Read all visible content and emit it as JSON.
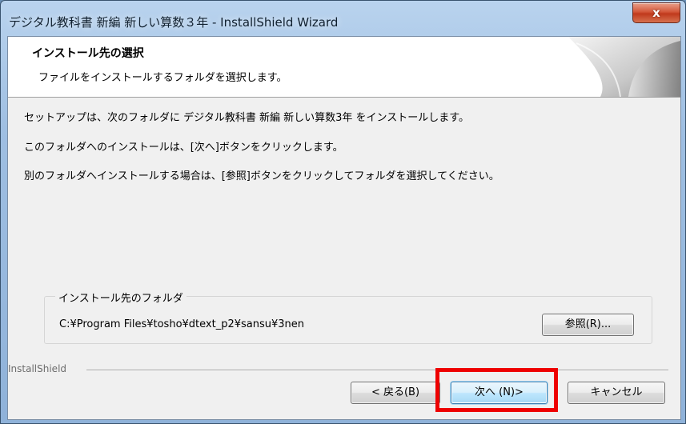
{
  "window": {
    "title": "デジタル教科書 新編 新しい算数３年 - InstallShield Wizard",
    "close_label": "x"
  },
  "header": {
    "title": "インストール先の選択",
    "subtitle": "ファイルをインストールするフォルダを選択します。"
  },
  "body": {
    "line1": "セットアップは、次のフォルダに デジタル教科書 新編 新しい算数3年 をインストールします。",
    "line2": "このフォルダへのインストールは、[次へ]ボタンをクリックします。",
    "line3": "別のフォルダへインストールする場合は、[参照]ボタンをクリックしてフォルダを選択してください。"
  },
  "destination": {
    "group_label": "インストール先のフォルダ",
    "path": "C:¥Program Files¥tosho¥dtext_p2¥sansu¥3nen",
    "browse_label": "参照(R)..."
  },
  "footer": {
    "brand": "InstallShield",
    "back_label": "< 戻る(B)",
    "next_label": "次へ (N)>",
    "cancel_label": "キャンセル"
  },
  "colors": {
    "highlight": "#ee0000",
    "close_button": "#c0391c"
  }
}
